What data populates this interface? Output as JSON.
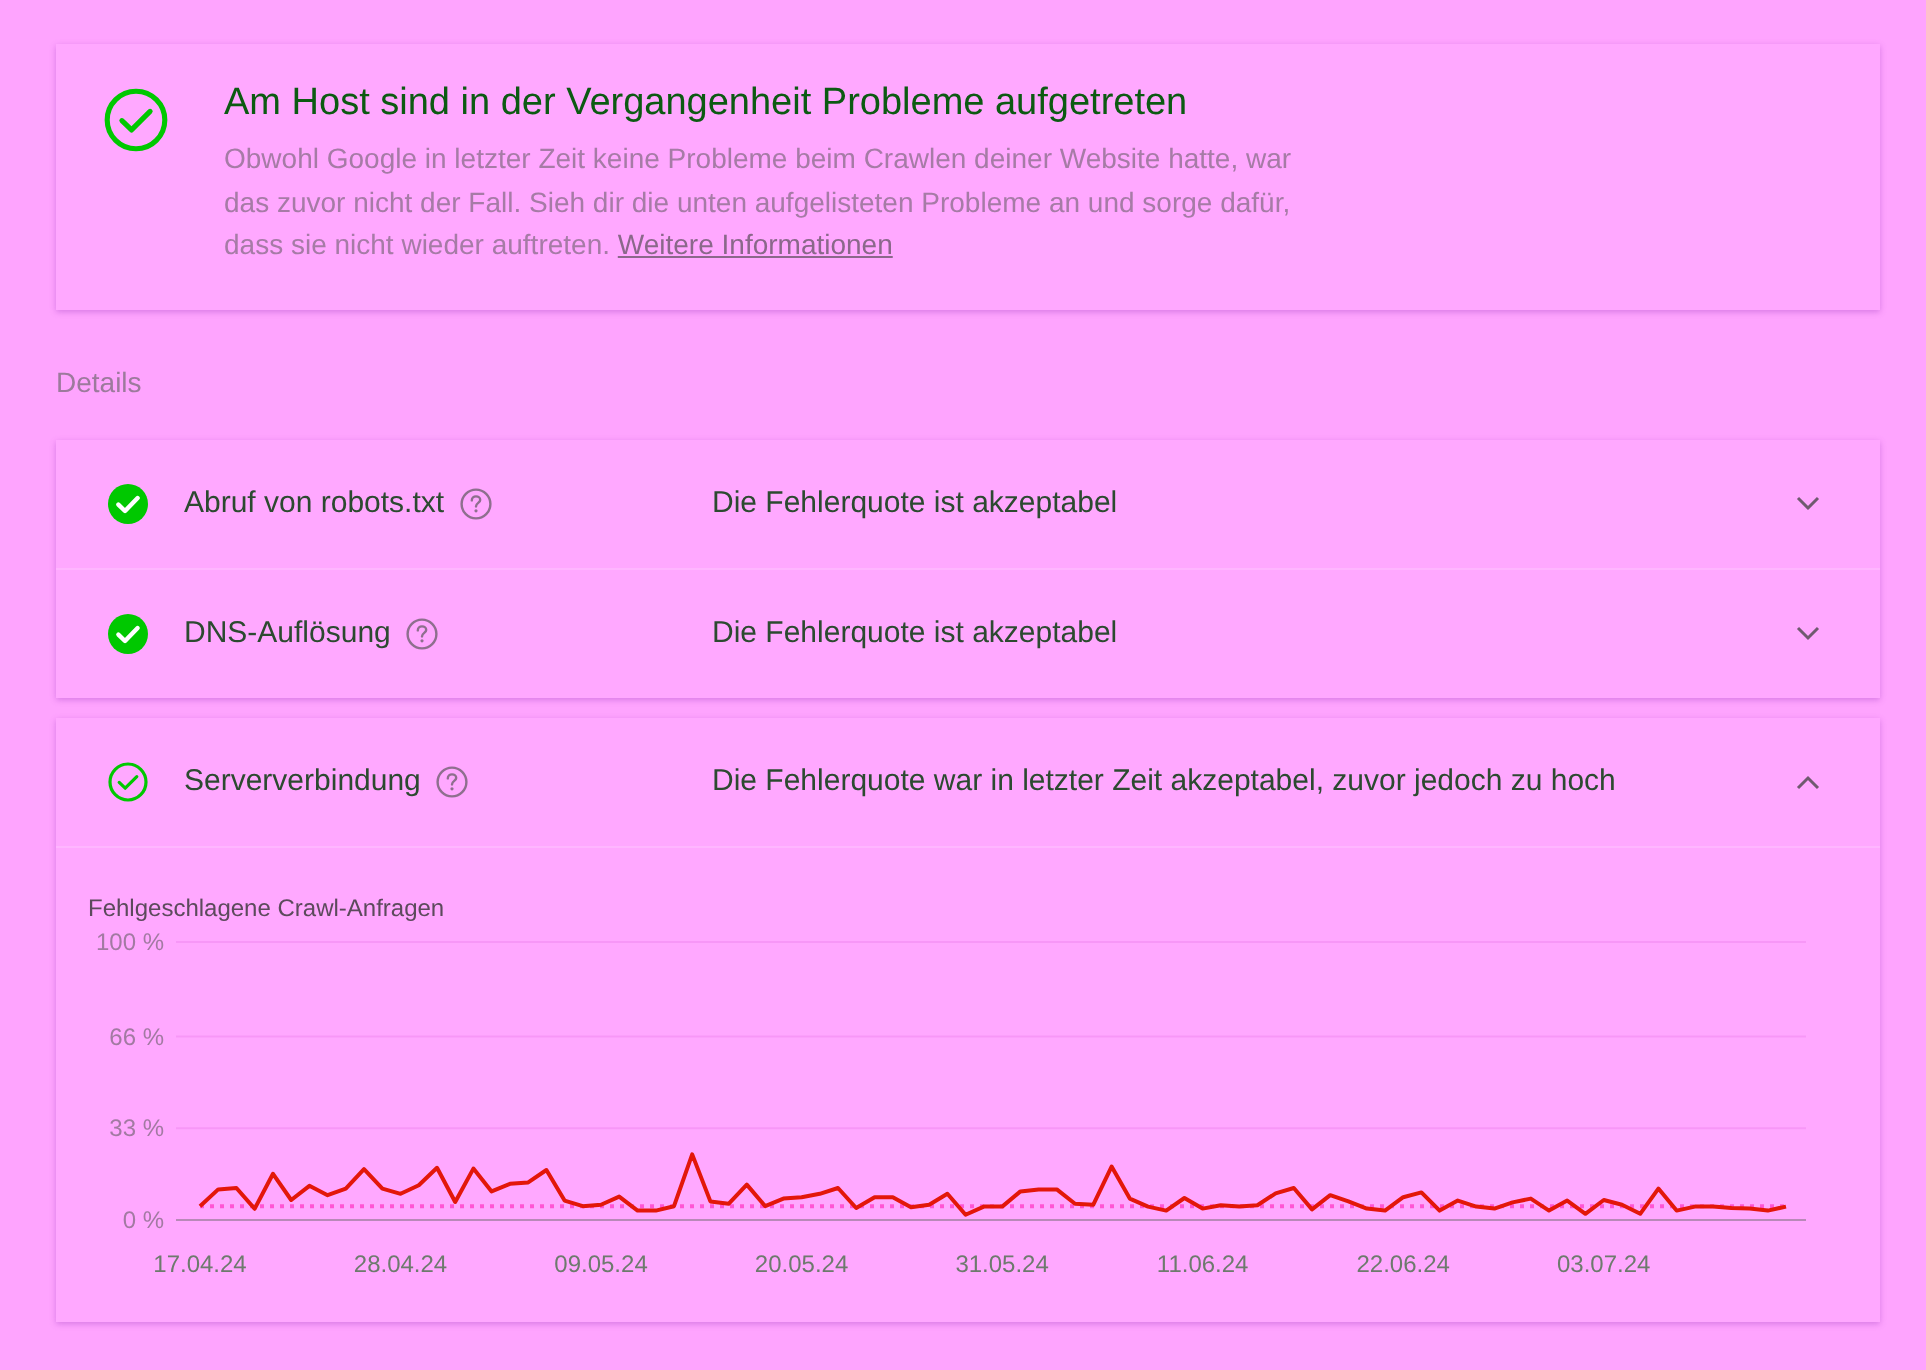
{
  "banner": {
    "title": "Am Host sind in der Vergangenheit Probleme aufgetreten",
    "text": "Obwohl Google in letzter Zeit keine Probleme beim Crawlen deiner Website hatte, war das zuvor nicht der Fall. Sieh dir die unten aufgelisteten Probleme an und sorge dafür, dass sie nicht wieder auftreten.",
    "link": "Weitere Informationen"
  },
  "section_label": "Details",
  "checks": [
    {
      "name": "Abruf von robots.txt",
      "kind": "passed",
      "message": "Die Fehlerquote ist akzeptabel",
      "expanded": false
    },
    {
      "name": "DNS-Auflösung",
      "kind": "passed",
      "message": "Die Fehlerquote ist akzeptabel",
      "expanded": false
    },
    {
      "name": "Serververbindung",
      "kind": "recovered",
      "message": "Die Fehlerquote war in letzter Zeit akzeptabel, zuvor jedoch zu hoch",
      "expanded": true,
      "chart_data": {
        "type": "line",
        "title": "Fehlgeschlagene Crawl-Anfragen",
        "categories": [
          "17.04.24",
          null,
          null,
          null,
          null,
          null,
          null,
          null,
          null,
          null,
          null,
          "28.04.24",
          null,
          null,
          null,
          null,
          null,
          null,
          null,
          null,
          null,
          null,
          "09.05.24",
          null,
          null,
          null,
          null,
          null,
          null,
          null,
          null,
          null,
          null,
          "20.05.24",
          null,
          null,
          null,
          null,
          null,
          null,
          null,
          null,
          null,
          null,
          "31.05.24",
          null,
          null,
          null,
          null,
          null,
          null,
          null,
          null,
          null,
          null,
          "11.06.24",
          null,
          null,
          null,
          null,
          null,
          null,
          null,
          null,
          null,
          null,
          "22.06.24",
          null,
          null,
          null,
          null,
          null,
          null,
          null,
          null,
          null,
          null,
          "03.07.24",
          null,
          null,
          null,
          null,
          null,
          null,
          null,
          null,
          null,
          null
        ],
        "series": [
          {
            "color": "#e3170a",
            "values": [
              5,
              11,
              11.5,
              4,
              16.6,
              7.2,
              12.3,
              8.9,
              11.3,
              18.3,
              11.3,
              9.4,
              12.5,
              18.8,
              6.5,
              18.5,
              10.3,
              13,
              13.5,
              18,
              7,
              5,
              5.5,
              8.4,
              3.4,
              3.4,
              5,
              23.6,
              6.7,
              5.8,
              12.7,
              5,
              7.7,
              8.2,
              9.4,
              11.5,
              4.3,
              8.2,
              8.2,
              4.6,
              5.5,
              9.4,
              1.9,
              4.8,
              4.8,
              10.3,
              11,
              11,
              5.8,
              5.5,
              19.2,
              7.7,
              4.8,
              3.4,
              7.9,
              4.1,
              5.3,
              4.8,
              5.3,
              9.6,
              11.5,
              3.8,
              8.9,
              6.7,
              4.1,
              3.4,
              8.2,
              9.9,
              3.4,
              7,
              4.8,
              4.1,
              6.3,
              7.7,
              3.4,
              7,
              2.2,
              7.2,
              5.5,
              2.2,
              11.3,
              3.4,
              4.8,
              4.8,
              4.3,
              4.1,
              3.4,
              4.8
            ]
          },
          {
            "line_style": "dotted",
            "color": "#ff55d4",
            "values": [
              5,
              5,
              5,
              5,
              5,
              5,
              5,
              5,
              5,
              5,
              5,
              5,
              5,
              5,
              5,
              5,
              5,
              5,
              5,
              5,
              5,
              5,
              5,
              5,
              5,
              5,
              5,
              5,
              5,
              5,
              5,
              5,
              5,
              5,
              5,
              5,
              5,
              5,
              5,
              5,
              5,
              5,
              5,
              5,
              5,
              5,
              5,
              5,
              5,
              5,
              5,
              5,
              5,
              5,
              5,
              5,
              5,
              5,
              5,
              5,
              5,
              5,
              5,
              5,
              5,
              5,
              5,
              5,
              5,
              5,
              5,
              5,
              5,
              5,
              5,
              5,
              5,
              5,
              5,
              5,
              5,
              5,
              5,
              5,
              5,
              5,
              5,
              5
            ]
          }
        ],
        "ylim": [
          0,
          100
        ],
        "yticks": [
          {
            "value": 0,
            "label": "0 %"
          },
          {
            "value": 33,
            "label": "33 %"
          },
          {
            "value": 66,
            "label": "66 %"
          },
          {
            "value": 100,
            "label": "100 %"
          }
        ]
      }
    }
  ]
}
